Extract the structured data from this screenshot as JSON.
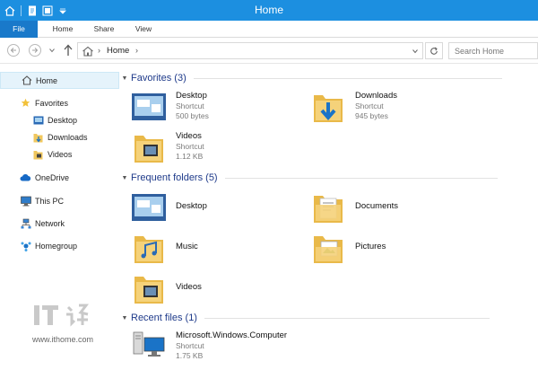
{
  "window": {
    "title": "Home"
  },
  "ribbon": {
    "file_label": "File",
    "tabs": [
      "Home",
      "Share",
      "View"
    ]
  },
  "address": {
    "path_label": "Home",
    "search_placeholder": "Search Home"
  },
  "nav": {
    "items": [
      {
        "label": "Home",
        "icon": "home-icon",
        "selected": true
      },
      {
        "label": "Favorites",
        "icon": "star-icon"
      },
      {
        "label": "Desktop",
        "icon": "desktop-icon"
      },
      {
        "label": "Downloads",
        "icon": "downloads-folder-icon"
      },
      {
        "label": "Videos",
        "icon": "videos-folder-icon"
      },
      {
        "label": "OneDrive",
        "icon": "cloud-icon"
      },
      {
        "label": "This PC",
        "icon": "computer-icon"
      },
      {
        "label": "Network",
        "icon": "network-icon"
      },
      {
        "label": "Homegroup",
        "icon": "homegroup-icon"
      }
    ]
  },
  "sections": {
    "favorites": {
      "title": "Favorites (3)",
      "items": [
        {
          "name": "Desktop",
          "type": "Shortcut",
          "size": "500 bytes",
          "icon": "desktop-icon"
        },
        {
          "name": "Downloads",
          "type": "Shortcut",
          "size": "945 bytes",
          "icon": "downloads-folder-icon"
        },
        {
          "name": "Videos",
          "type": "Shortcut",
          "size": "1.12 KB",
          "icon": "videos-folder-icon"
        }
      ]
    },
    "frequent": {
      "title": "Frequent folders (5)",
      "items": [
        {
          "name": "Desktop",
          "icon": "desktop-icon"
        },
        {
          "name": "Documents",
          "icon": "documents-folder-icon"
        },
        {
          "name": "Music",
          "icon": "music-folder-icon"
        },
        {
          "name": "Pictures",
          "icon": "pictures-folder-icon"
        },
        {
          "name": "Videos",
          "icon": "videos-folder-icon"
        }
      ]
    },
    "recent": {
      "title": "Recent files (1)",
      "items": [
        {
          "name": "Microsoft.Windows.Computer",
          "type": "Shortcut",
          "size": "1.75 KB",
          "icon": "computer-icon"
        }
      ]
    }
  },
  "watermark": {
    "logo_text": "IT之家",
    "url": "www.ithome.com"
  },
  "colors": {
    "titlebar": "#1c8fe0",
    "file_tab": "#1979ca",
    "section_title": "#1e3a8a",
    "folder": "#f0c75e",
    "selection": "#e5f3fb"
  }
}
